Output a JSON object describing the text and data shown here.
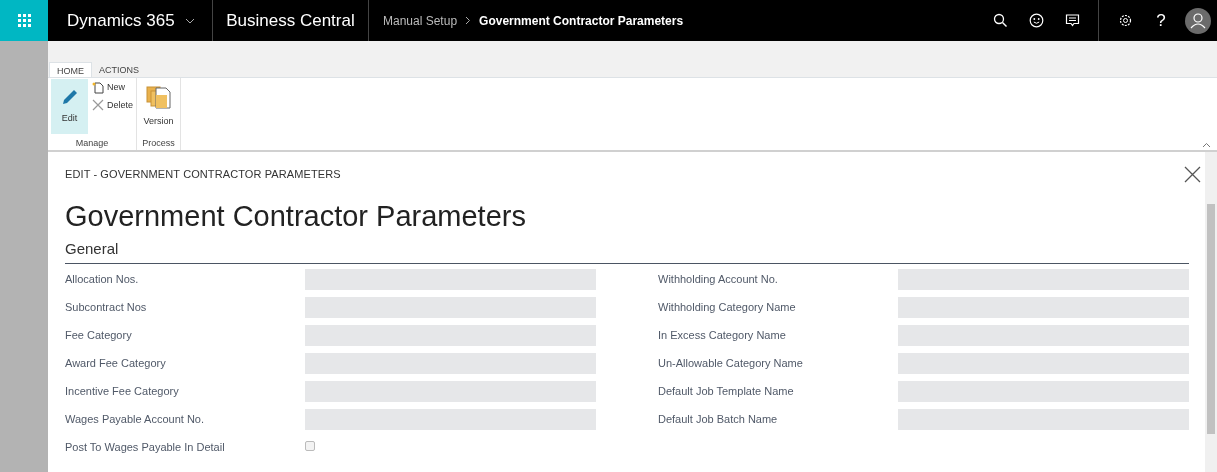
{
  "top_bar": {
    "product": "Dynamics 365",
    "app": "Business Central",
    "breadcrumb": [
      "Manual Setup",
      "Government Contractor Parameters"
    ],
    "help": "?"
  },
  "ribbon": {
    "tabs": [
      {
        "label": "HOME",
        "selected": true
      },
      {
        "label": "ACTIONS",
        "selected": false
      }
    ],
    "groups": [
      {
        "label": "Manage",
        "actions": [
          {
            "label": "Edit",
            "kind": "large",
            "selected": true
          },
          {
            "label": "New",
            "kind": "small",
            "selected": false
          },
          {
            "label": "Delete",
            "kind": "small",
            "selected": false
          }
        ]
      },
      {
        "label": "Process",
        "actions": [
          {
            "label": "Version",
            "kind": "large",
            "selected": false
          }
        ]
      }
    ]
  },
  "page": {
    "caption": "EDIT - GOVERNMENT CONTRACTOR PARAMETERS",
    "title": "Government Contractor Parameters",
    "section": "General",
    "left_fields": [
      {
        "label": "Allocation Nos.",
        "kind": "text"
      },
      {
        "label": "Subcontract Nos",
        "kind": "text"
      },
      {
        "label": "Fee Category",
        "kind": "text"
      },
      {
        "label": "Award Fee Category",
        "kind": "text"
      },
      {
        "label": "Incentive Fee Category",
        "kind": "text"
      },
      {
        "label": "Wages Payable Account No.",
        "kind": "text"
      },
      {
        "label": "Post To Wages Payable In Detail",
        "kind": "checkbox",
        "checked": false
      }
    ],
    "right_fields": [
      {
        "label": "Withholding Account No.",
        "kind": "text"
      },
      {
        "label": "Withholding Category Name",
        "kind": "text"
      },
      {
        "label": "In Excess Category Name",
        "kind": "text"
      },
      {
        "label": "Un-Allowable Category Name",
        "kind": "text"
      },
      {
        "label": "Default Job Template Name",
        "kind": "text"
      },
      {
        "label": "Default Job Batch Name",
        "kind": "text"
      }
    ]
  }
}
